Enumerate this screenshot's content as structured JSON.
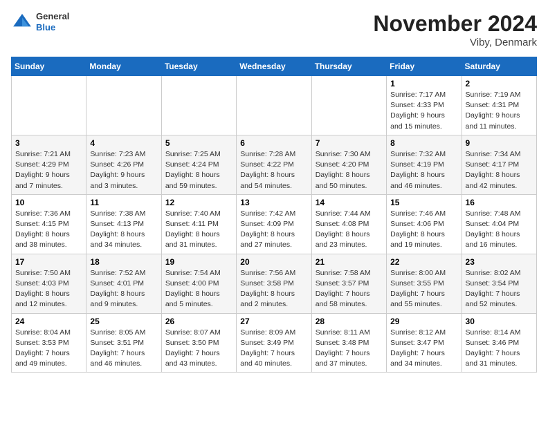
{
  "logo": {
    "general": "General",
    "blue": "Blue"
  },
  "title": "November 2024",
  "subtitle": "Viby, Denmark",
  "days_of_week": [
    "Sunday",
    "Monday",
    "Tuesday",
    "Wednesday",
    "Thursday",
    "Friday",
    "Saturday"
  ],
  "weeks": [
    [
      {
        "day": "",
        "info": ""
      },
      {
        "day": "",
        "info": ""
      },
      {
        "day": "",
        "info": ""
      },
      {
        "day": "",
        "info": ""
      },
      {
        "day": "",
        "info": ""
      },
      {
        "day": "1",
        "info": "Sunrise: 7:17 AM\nSunset: 4:33 PM\nDaylight: 9 hours and 15 minutes."
      },
      {
        "day": "2",
        "info": "Sunrise: 7:19 AM\nSunset: 4:31 PM\nDaylight: 9 hours and 11 minutes."
      }
    ],
    [
      {
        "day": "3",
        "info": "Sunrise: 7:21 AM\nSunset: 4:29 PM\nDaylight: 9 hours and 7 minutes."
      },
      {
        "day": "4",
        "info": "Sunrise: 7:23 AM\nSunset: 4:26 PM\nDaylight: 9 hours and 3 minutes."
      },
      {
        "day": "5",
        "info": "Sunrise: 7:25 AM\nSunset: 4:24 PM\nDaylight: 8 hours and 59 minutes."
      },
      {
        "day": "6",
        "info": "Sunrise: 7:28 AM\nSunset: 4:22 PM\nDaylight: 8 hours and 54 minutes."
      },
      {
        "day": "7",
        "info": "Sunrise: 7:30 AM\nSunset: 4:20 PM\nDaylight: 8 hours and 50 minutes."
      },
      {
        "day": "8",
        "info": "Sunrise: 7:32 AM\nSunset: 4:19 PM\nDaylight: 8 hours and 46 minutes."
      },
      {
        "day": "9",
        "info": "Sunrise: 7:34 AM\nSunset: 4:17 PM\nDaylight: 8 hours and 42 minutes."
      }
    ],
    [
      {
        "day": "10",
        "info": "Sunrise: 7:36 AM\nSunset: 4:15 PM\nDaylight: 8 hours and 38 minutes."
      },
      {
        "day": "11",
        "info": "Sunrise: 7:38 AM\nSunset: 4:13 PM\nDaylight: 8 hours and 34 minutes."
      },
      {
        "day": "12",
        "info": "Sunrise: 7:40 AM\nSunset: 4:11 PM\nDaylight: 8 hours and 31 minutes."
      },
      {
        "day": "13",
        "info": "Sunrise: 7:42 AM\nSunset: 4:09 PM\nDaylight: 8 hours and 27 minutes."
      },
      {
        "day": "14",
        "info": "Sunrise: 7:44 AM\nSunset: 4:08 PM\nDaylight: 8 hours and 23 minutes."
      },
      {
        "day": "15",
        "info": "Sunrise: 7:46 AM\nSunset: 4:06 PM\nDaylight: 8 hours and 19 minutes."
      },
      {
        "day": "16",
        "info": "Sunrise: 7:48 AM\nSunset: 4:04 PM\nDaylight: 8 hours and 16 minutes."
      }
    ],
    [
      {
        "day": "17",
        "info": "Sunrise: 7:50 AM\nSunset: 4:03 PM\nDaylight: 8 hours and 12 minutes."
      },
      {
        "day": "18",
        "info": "Sunrise: 7:52 AM\nSunset: 4:01 PM\nDaylight: 8 hours and 9 minutes."
      },
      {
        "day": "19",
        "info": "Sunrise: 7:54 AM\nSunset: 4:00 PM\nDaylight: 8 hours and 5 minutes."
      },
      {
        "day": "20",
        "info": "Sunrise: 7:56 AM\nSunset: 3:58 PM\nDaylight: 8 hours and 2 minutes."
      },
      {
        "day": "21",
        "info": "Sunrise: 7:58 AM\nSunset: 3:57 PM\nDaylight: 7 hours and 58 minutes."
      },
      {
        "day": "22",
        "info": "Sunrise: 8:00 AM\nSunset: 3:55 PM\nDaylight: 7 hours and 55 minutes."
      },
      {
        "day": "23",
        "info": "Sunrise: 8:02 AM\nSunset: 3:54 PM\nDaylight: 7 hours and 52 minutes."
      }
    ],
    [
      {
        "day": "24",
        "info": "Sunrise: 8:04 AM\nSunset: 3:53 PM\nDaylight: 7 hours and 49 minutes."
      },
      {
        "day": "25",
        "info": "Sunrise: 8:05 AM\nSunset: 3:51 PM\nDaylight: 7 hours and 46 minutes."
      },
      {
        "day": "26",
        "info": "Sunrise: 8:07 AM\nSunset: 3:50 PM\nDaylight: 7 hours and 43 minutes."
      },
      {
        "day": "27",
        "info": "Sunrise: 8:09 AM\nSunset: 3:49 PM\nDaylight: 7 hours and 40 minutes."
      },
      {
        "day": "28",
        "info": "Sunrise: 8:11 AM\nSunset: 3:48 PM\nDaylight: 7 hours and 37 minutes."
      },
      {
        "day": "29",
        "info": "Sunrise: 8:12 AM\nSunset: 3:47 PM\nDaylight: 7 hours and 34 minutes."
      },
      {
        "day": "30",
        "info": "Sunrise: 8:14 AM\nSunset: 3:46 PM\nDaylight: 7 hours and 31 minutes."
      }
    ]
  ]
}
